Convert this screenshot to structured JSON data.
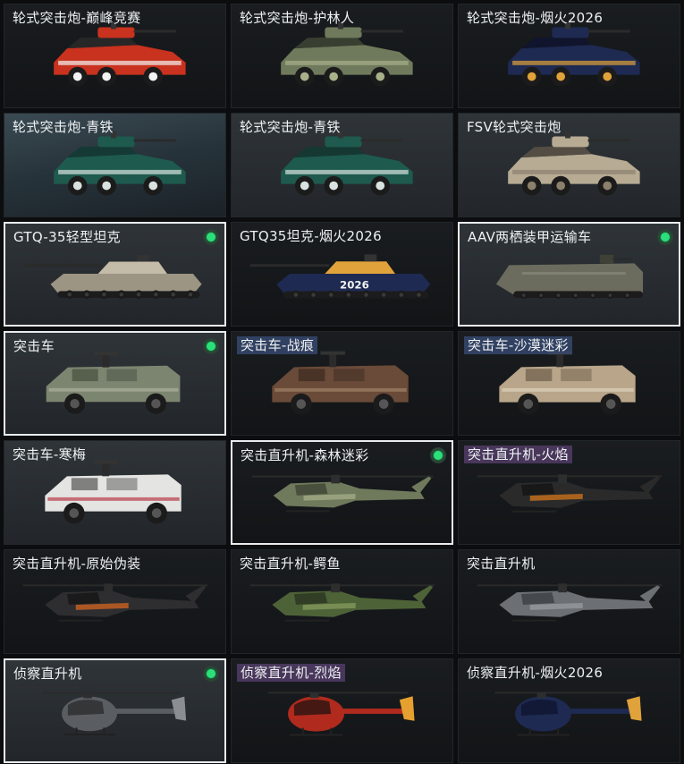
{
  "items": [
    {
      "label": "轮式突击炮-巅峰竞赛",
      "kind": "wheeled-gun",
      "paint": "red-racing",
      "owned": false,
      "selected": false,
      "tag": "plain",
      "bg": "dark"
    },
    {
      "label": "轮式突击炮-护林人",
      "kind": "wheeled-gun",
      "paint": "forest-camo",
      "owned": false,
      "selected": false,
      "tag": "plain",
      "bg": "dark"
    },
    {
      "label": "轮式突击炮-烟火2026",
      "kind": "wheeled-gun",
      "paint": "fireworks-navy",
      "owned": false,
      "selected": false,
      "tag": "plain",
      "bg": "dark"
    },
    {
      "label": "轮式突击炮-青铁",
      "kind": "wheeled-gun",
      "paint": "teal",
      "owned": false,
      "selected": false,
      "tag": "plain",
      "bg": "teal"
    },
    {
      "label": "轮式突击炮-青铁",
      "kind": "wheeled-gun",
      "paint": "teal",
      "owned": false,
      "selected": false,
      "tag": "plain",
      "bg": "mid"
    },
    {
      "label": "FSV轮式突击炮",
      "kind": "wheeled-gun",
      "paint": "desert",
      "owned": false,
      "selected": false,
      "tag": "plain",
      "bg": "mid"
    },
    {
      "label": "GTQ-35轻型坦克",
      "kind": "tank",
      "paint": "desert-grey",
      "owned": true,
      "selected": true,
      "tag": "plain",
      "bg": "mid"
    },
    {
      "label": "GTQ35坦克-烟火2026",
      "kind": "tank",
      "paint": "fireworks-navy",
      "owned": false,
      "selected": false,
      "tag": "plain",
      "bg": "dark",
      "decal": "2026"
    },
    {
      "label": "AAV两栖装甲运输车",
      "kind": "amphibious",
      "paint": "olive-grey",
      "owned": true,
      "selected": true,
      "tag": "plain",
      "bg": "mid"
    },
    {
      "label": "突击车",
      "kind": "assault-car",
      "paint": "green-camo",
      "owned": true,
      "selected": true,
      "tag": "plain",
      "bg": "mid"
    },
    {
      "label": "突击车-战痕",
      "kind": "assault-car",
      "paint": "rust",
      "owned": false,
      "selected": false,
      "tag": "blue",
      "bg": "dark"
    },
    {
      "label": "突击车-沙漠迷彩",
      "kind": "assault-car",
      "paint": "desert-camo",
      "owned": false,
      "selected": false,
      "tag": "blue",
      "bg": "dark"
    },
    {
      "label": "突击车-寒梅",
      "kind": "assault-car",
      "paint": "white-plum",
      "owned": false,
      "selected": false,
      "tag": "plain",
      "bg": "mid"
    },
    {
      "label": "突击直升机-森林迷彩",
      "kind": "attack-heli",
      "paint": "forest-camo",
      "owned": true,
      "selected": true,
      "tag": "plain",
      "bg": "dark"
    },
    {
      "label": "突击直升机-火焰",
      "kind": "attack-heli",
      "paint": "flame",
      "owned": false,
      "selected": false,
      "tag": "purple",
      "bg": "dark"
    },
    {
      "label": "突击直升机-原始伪装",
      "kind": "attack-heli",
      "paint": "orange-black",
      "owned": false,
      "selected": false,
      "tag": "plain",
      "bg": "dark"
    },
    {
      "label": "突击直升机-鳄鱼",
      "kind": "attack-heli",
      "paint": "croc-green",
      "owned": false,
      "selected": false,
      "tag": "plain",
      "bg": "dark"
    },
    {
      "label": "突击直升机",
      "kind": "attack-heli",
      "paint": "grey",
      "owned": false,
      "selected": false,
      "tag": "plain",
      "bg": "dark"
    },
    {
      "label": "侦察直升机",
      "kind": "scout-heli",
      "paint": "grey-black",
      "owned": true,
      "selected": true,
      "tag": "plain",
      "bg": "mid"
    },
    {
      "label": "侦察直升机-烈焰",
      "kind": "scout-heli",
      "paint": "red-flame",
      "owned": false,
      "selected": false,
      "tag": "purple",
      "bg": "dark"
    },
    {
      "label": "侦察直升机-烟火2026",
      "kind": "scout-heli",
      "paint": "fireworks-navy",
      "owned": false,
      "selected": false,
      "tag": "plain",
      "bg": "dark"
    }
  ],
  "colors": {
    "owned_indicator": "#2be07a",
    "selected_border": "#e8ecef",
    "tag_blue": "#3a4e78",
    "tag_purple": "#584070"
  },
  "icons": {
    "owned": "green-dot-icon"
  }
}
